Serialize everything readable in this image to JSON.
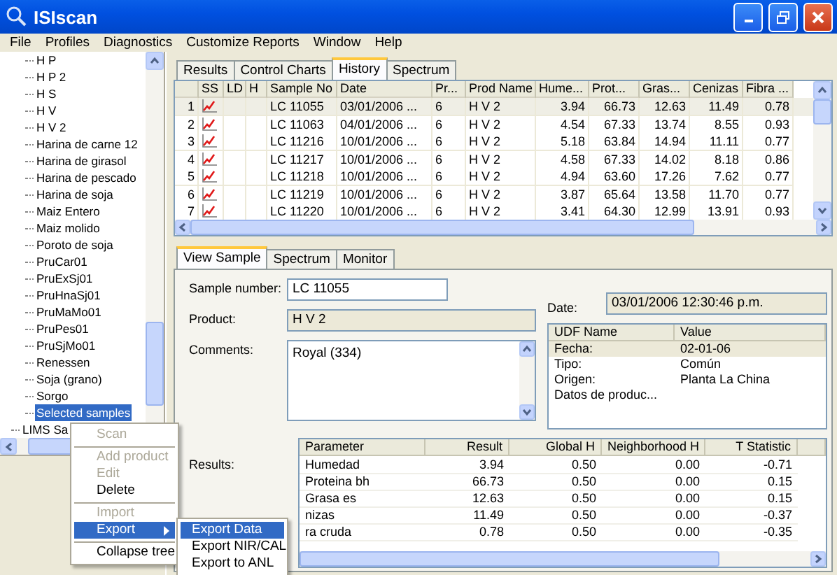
{
  "window": {
    "title": "ISIscan"
  },
  "menu_bar": [
    "File",
    "Profiles",
    "Diagnostics",
    "Customize Reports",
    "Window",
    "Help"
  ],
  "tree": [
    {
      "children": [
        {
          "label": "H P",
          "selected": false
        },
        {
          "label": "H P 2",
          "selected": false
        },
        {
          "label": "H S",
          "selected": false
        },
        {
          "label": "H V",
          "selected": false
        },
        {
          "label": "H V 2",
          "selected": false
        },
        {
          "label": "Harina de carne  12",
          "selected": false
        },
        {
          "label": "Harina de girasol",
          "selected": false
        },
        {
          "label": "Harina de pescado",
          "selected": false
        },
        {
          "label": "Harina de soja",
          "selected": false
        },
        {
          "label": "Maiz Entero",
          "selected": false
        },
        {
          "label": "Maiz molido",
          "selected": false
        },
        {
          "label": "Poroto de soja",
          "selected": false
        },
        {
          "label": "PruCar01",
          "selected": false
        },
        {
          "label": "PruExSj01",
          "selected": false
        },
        {
          "label": "PruHnaSj01",
          "selected": false
        },
        {
          "label": "PruMaMo01",
          "selected": false
        },
        {
          "label": "PruPes01",
          "selected": false
        },
        {
          "label": "PruSjMo01",
          "selected": false
        },
        {
          "label": "Renessen",
          "selected": false
        },
        {
          "label": "Soja (grano)",
          "selected": false
        },
        {
          "label": "Sorgo",
          "selected": false
        },
        {
          "label": "Selected samples",
          "selected": true
        }
      ]
    },
    {
      "label": "LIMS Sa",
      "selected": false
    }
  ],
  "upper_tabs": [
    {
      "label": "Results",
      "selected": false
    },
    {
      "label": "Control Charts",
      "selected": false
    },
    {
      "label": "History",
      "selected": true
    },
    {
      "label": "Spectrum",
      "selected": false
    }
  ],
  "history_table": {
    "columns": [
      "SS",
      "LD",
      "H",
      "Sample No",
      "Date",
      "Pr...",
      "Prod Name",
      "Hume...",
      "Prot...",
      "Gras...",
      "Cenizas",
      "Fibra ..."
    ],
    "rows": [
      {
        "number": "1",
        "sample_no": "LC 11055",
        "date": "03/01/2006 ...",
        "pr": "6",
        "prod_name": "H V 2",
        "values": [
          "3.94",
          "66.73",
          "12.63",
          "11.49",
          "0.78"
        ],
        "selected": true
      },
      {
        "number": "2",
        "sample_no": "LC 11063",
        "date": "04/01/2006 ...",
        "pr": "6",
        "prod_name": "H V 2",
        "values": [
          "4.54",
          "67.33",
          "13.74",
          "8.55",
          "0.93"
        ],
        "selected": false
      },
      {
        "number": "3",
        "sample_no": "LC 11216",
        "date": "10/01/2006 ...",
        "pr": "6",
        "prod_name": "H V 2",
        "values": [
          "5.18",
          "63.84",
          "14.94",
          "11.11",
          "0.77"
        ],
        "selected": false
      },
      {
        "number": "4",
        "sample_no": "LC 11217",
        "date": "10/01/2006 ...",
        "pr": "6",
        "prod_name": "H V 2",
        "values": [
          "4.58",
          "67.33",
          "14.02",
          "8.18",
          "0.86"
        ],
        "selected": false
      },
      {
        "number": "5",
        "sample_no": "LC 11218",
        "date": "10/01/2006 ...",
        "pr": "6",
        "prod_name": "H V 2",
        "values": [
          "4.94",
          "63.60",
          "17.26",
          "7.62",
          "0.77"
        ],
        "selected": false
      },
      {
        "number": "6",
        "sample_no": "LC 11219",
        "date": "10/01/2006 ...",
        "pr": "6",
        "prod_name": "H V 2",
        "values": [
          "3.87",
          "65.64",
          "13.58",
          "11.70",
          "0.77"
        ],
        "selected": false
      },
      {
        "number": "7",
        "sample_no": "LC 11220",
        "date": "10/01/2006 ...",
        "pr": "6",
        "prod_name": "H V 2",
        "values": [
          "3.41",
          "64.30",
          "12.99",
          "13.91",
          "0.93"
        ],
        "selected": false
      }
    ]
  },
  "lower_tabs": [
    {
      "label": "View Sample",
      "selected": true
    },
    {
      "label": "Spectrum",
      "selected": false
    },
    {
      "label": "Monitor",
      "selected": false
    }
  ],
  "sample": {
    "sample_number_label": "Sample number:",
    "sample_number": "LC 11055",
    "product_label": "Product:",
    "product": "H V 2",
    "comments_label": "Comments:",
    "comments": "Royal   (334)",
    "date_label": "Date:",
    "date": "03/01/2006 12:30:46 p.m.",
    "results_label": "Results:"
  },
  "udf_table": {
    "columns": [
      "UDF Name",
      "Value"
    ],
    "rows": [
      {
        "name": "Fecha:",
        "value": "02-01-06",
        "selected": true
      },
      {
        "name": "Tipo:",
        "value": "Común",
        "selected": false
      },
      {
        "name": "Origen:",
        "value": "Planta La China",
        "selected": false
      },
      {
        "name": "Datos de produc...",
        "value": "",
        "selected": false
      }
    ]
  },
  "results_table": {
    "columns": [
      "Parameter",
      "Result",
      "Global H",
      "Neighborhood H",
      "T Statistic"
    ],
    "rows": [
      [
        "Humedad",
        "3.94",
        "0.50",
        "0.00",
        "-0.71"
      ],
      [
        "Proteina bh",
        "66.73",
        "0.50",
        "0.00",
        "0.15"
      ],
      [
        "Grasa es",
        "12.63",
        "0.50",
        "0.00",
        "0.15"
      ],
      [
        "nizas",
        "11.49",
        "0.50",
        "0.00",
        "-0.37"
      ],
      [
        "ra cruda",
        "0.78",
        "0.50",
        "0.00",
        "-0.35"
      ]
    ]
  },
  "context_menu": [
    {
      "kind": "item",
      "label": "Scan",
      "disabled": true,
      "selected": false
    },
    {
      "kind": "separator"
    },
    {
      "kind": "item",
      "label": "Add product",
      "disabled": true,
      "selected": false
    },
    {
      "kind": "item",
      "label": "Edit",
      "disabled": true,
      "selected": false
    },
    {
      "kind": "item",
      "label": "Delete",
      "disabled": false,
      "selected": false
    },
    {
      "kind": "separator"
    },
    {
      "kind": "item",
      "label": "Import",
      "disabled": true,
      "selected": false
    },
    {
      "kind": "item",
      "label": "Export",
      "disabled": false,
      "selected": true,
      "submenu": true
    },
    {
      "kind": "separator"
    },
    {
      "kind": "item",
      "label": "Collapse tree",
      "disabled": false,
      "selected": false
    }
  ],
  "submenu": [
    {
      "label": "Export Data",
      "selected": true
    },
    {
      "label": "Export NIR/CAL",
      "selected": false
    },
    {
      "label": "Export to ANL",
      "selected": false
    }
  ]
}
